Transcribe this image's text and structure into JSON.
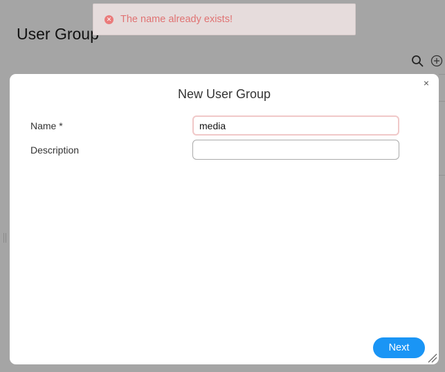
{
  "page": {
    "title": "User Group"
  },
  "toolbar": {
    "search_icon": "search-icon",
    "add_icon": "plus-circle-icon"
  },
  "toast": {
    "message": "The name already exists!",
    "icon": "error-circle-icon",
    "icon_glyph": "✕",
    "text_color": "#e07373"
  },
  "dialog": {
    "title": "New User Group",
    "close_glyph": "×",
    "fields": {
      "name": {
        "label": "Name *",
        "value": "media"
      },
      "description": {
        "label": "Description",
        "value": ""
      }
    },
    "next_label": "Next",
    "accent_color": "#1a95f5"
  }
}
